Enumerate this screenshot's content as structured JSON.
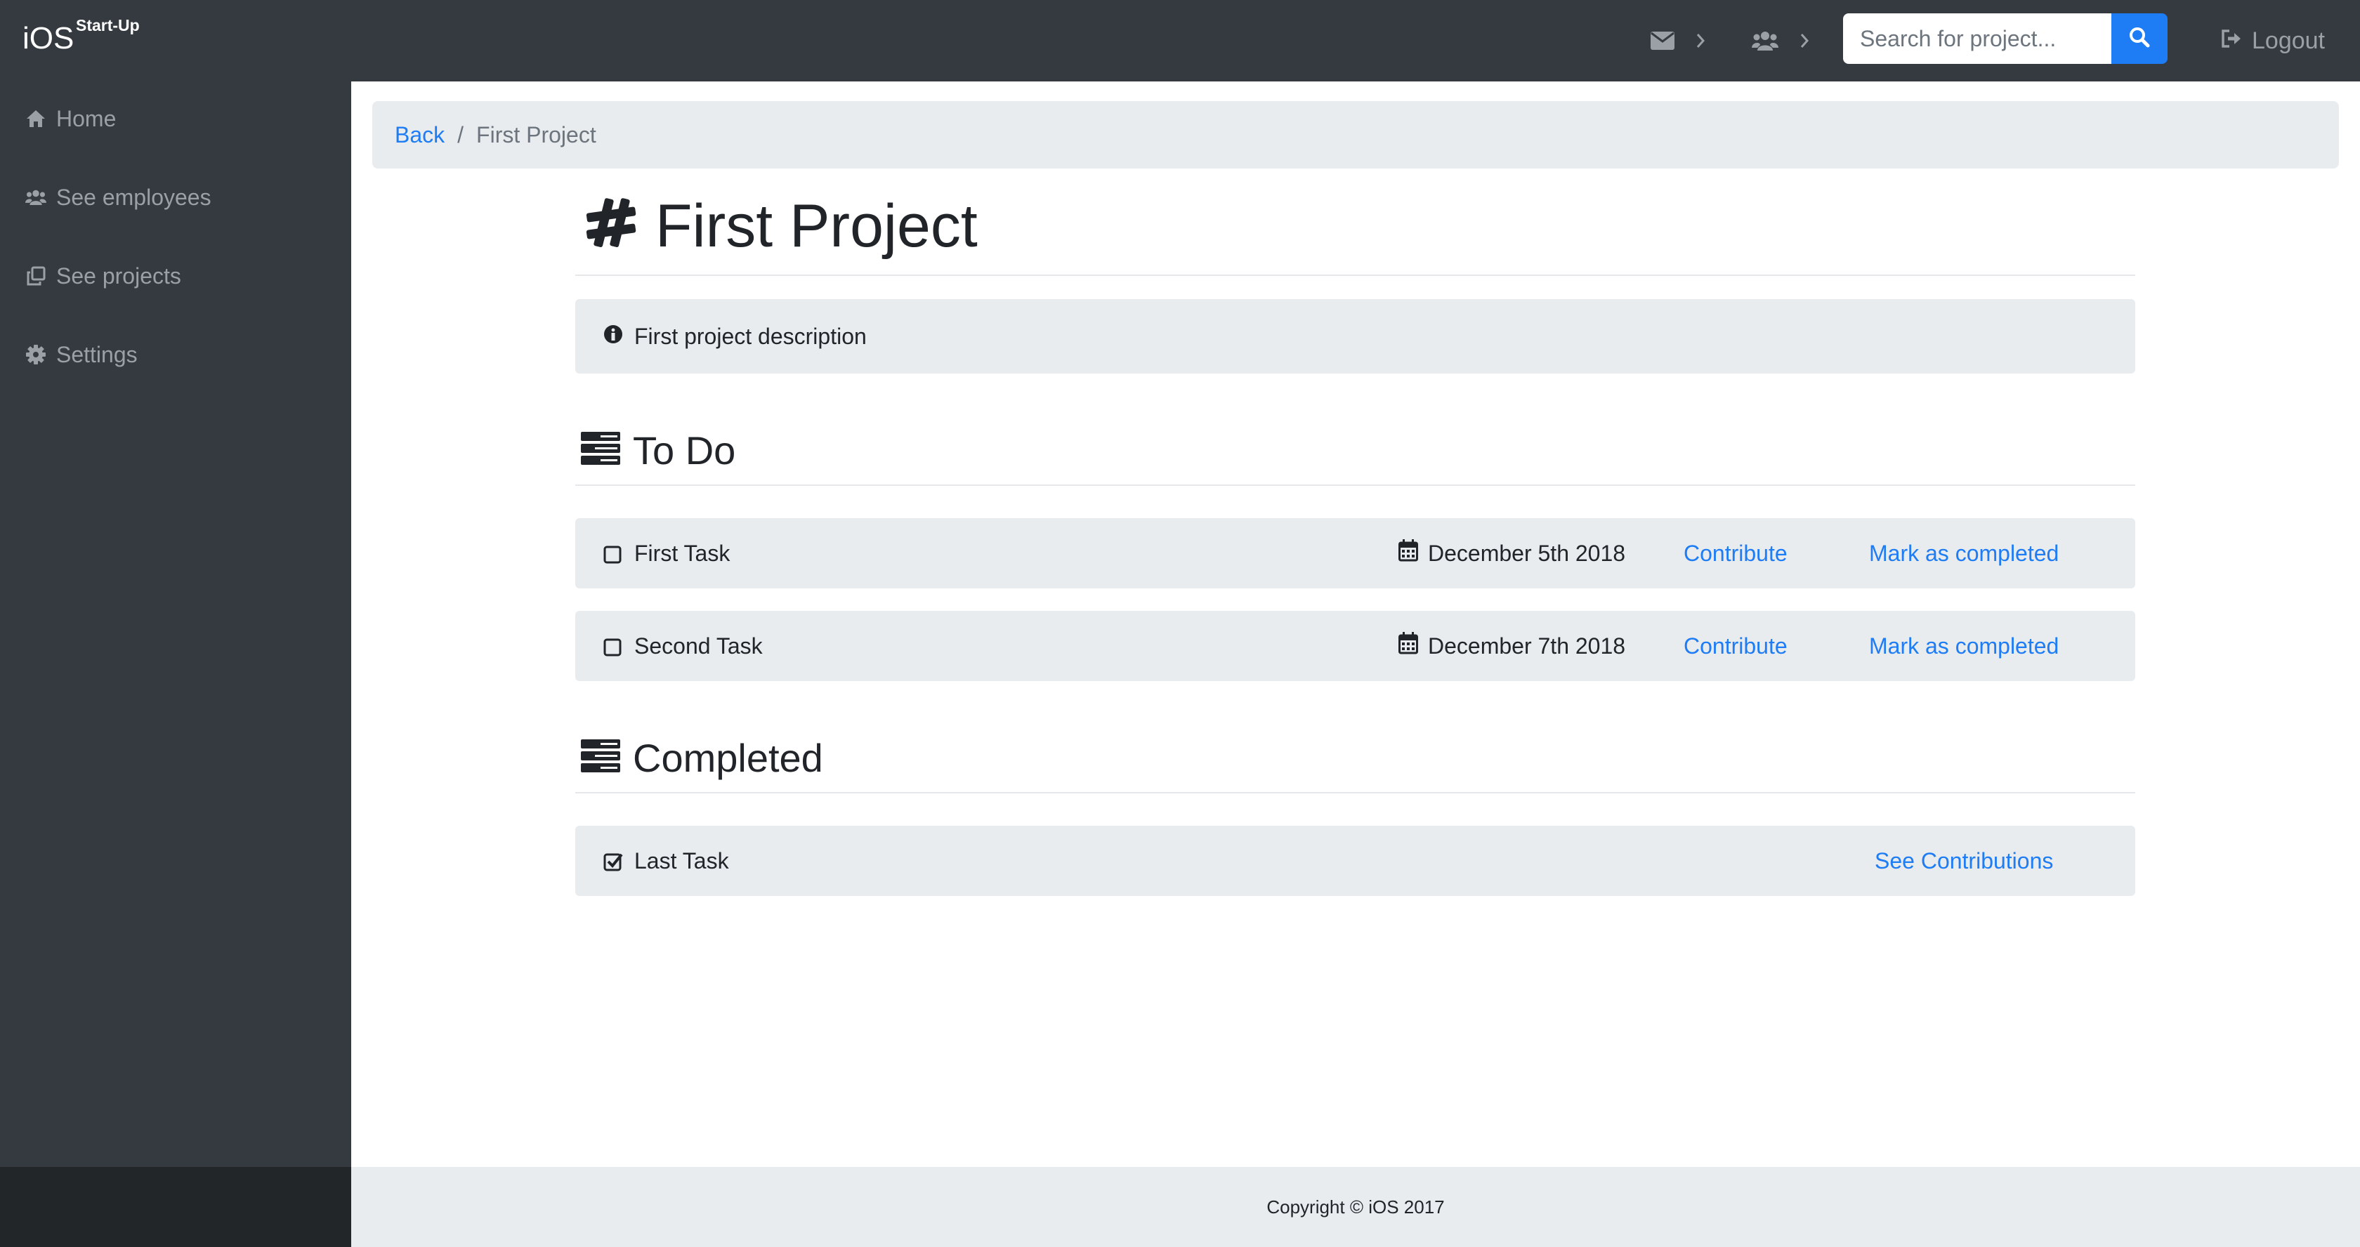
{
  "navbar": {
    "brand": "iOS",
    "brand_sup": "Start-Up",
    "icons": [
      "envelope-icon",
      "users-icon"
    ],
    "search_placeholder": "Search for project...",
    "logout_label": "Logout"
  },
  "sidebar": {
    "items": [
      {
        "label": "Home",
        "icon": "home-icon"
      },
      {
        "label": "See employees",
        "icon": "users-icon"
      },
      {
        "label": "See projects",
        "icon": "clone-icon"
      },
      {
        "label": "Settings",
        "icon": "gear-icon"
      }
    ]
  },
  "breadcrumb": {
    "back": "Back",
    "separator": "/",
    "current": "First Project"
  },
  "project": {
    "title": "First Project",
    "description": "First project description"
  },
  "todo": {
    "title": "To Do",
    "tasks": [
      {
        "name": "First Task",
        "date": "December 5th 2018",
        "contribute": "Contribute",
        "complete": "Mark as completed"
      },
      {
        "name": "Second Task",
        "date": "December 7th 2018",
        "contribute": "Contribute",
        "complete": "Mark as completed"
      }
    ]
  },
  "completed": {
    "title": "Completed",
    "tasks": [
      {
        "name": "Last Task",
        "link": "See Contributions"
      }
    ]
  },
  "footer": {
    "text": "Copyright © iOS 2017"
  },
  "colors": {
    "navbar_bg": "#343a40",
    "accent": "#1e7cf5",
    "panel_bg": "#e9ecef"
  }
}
